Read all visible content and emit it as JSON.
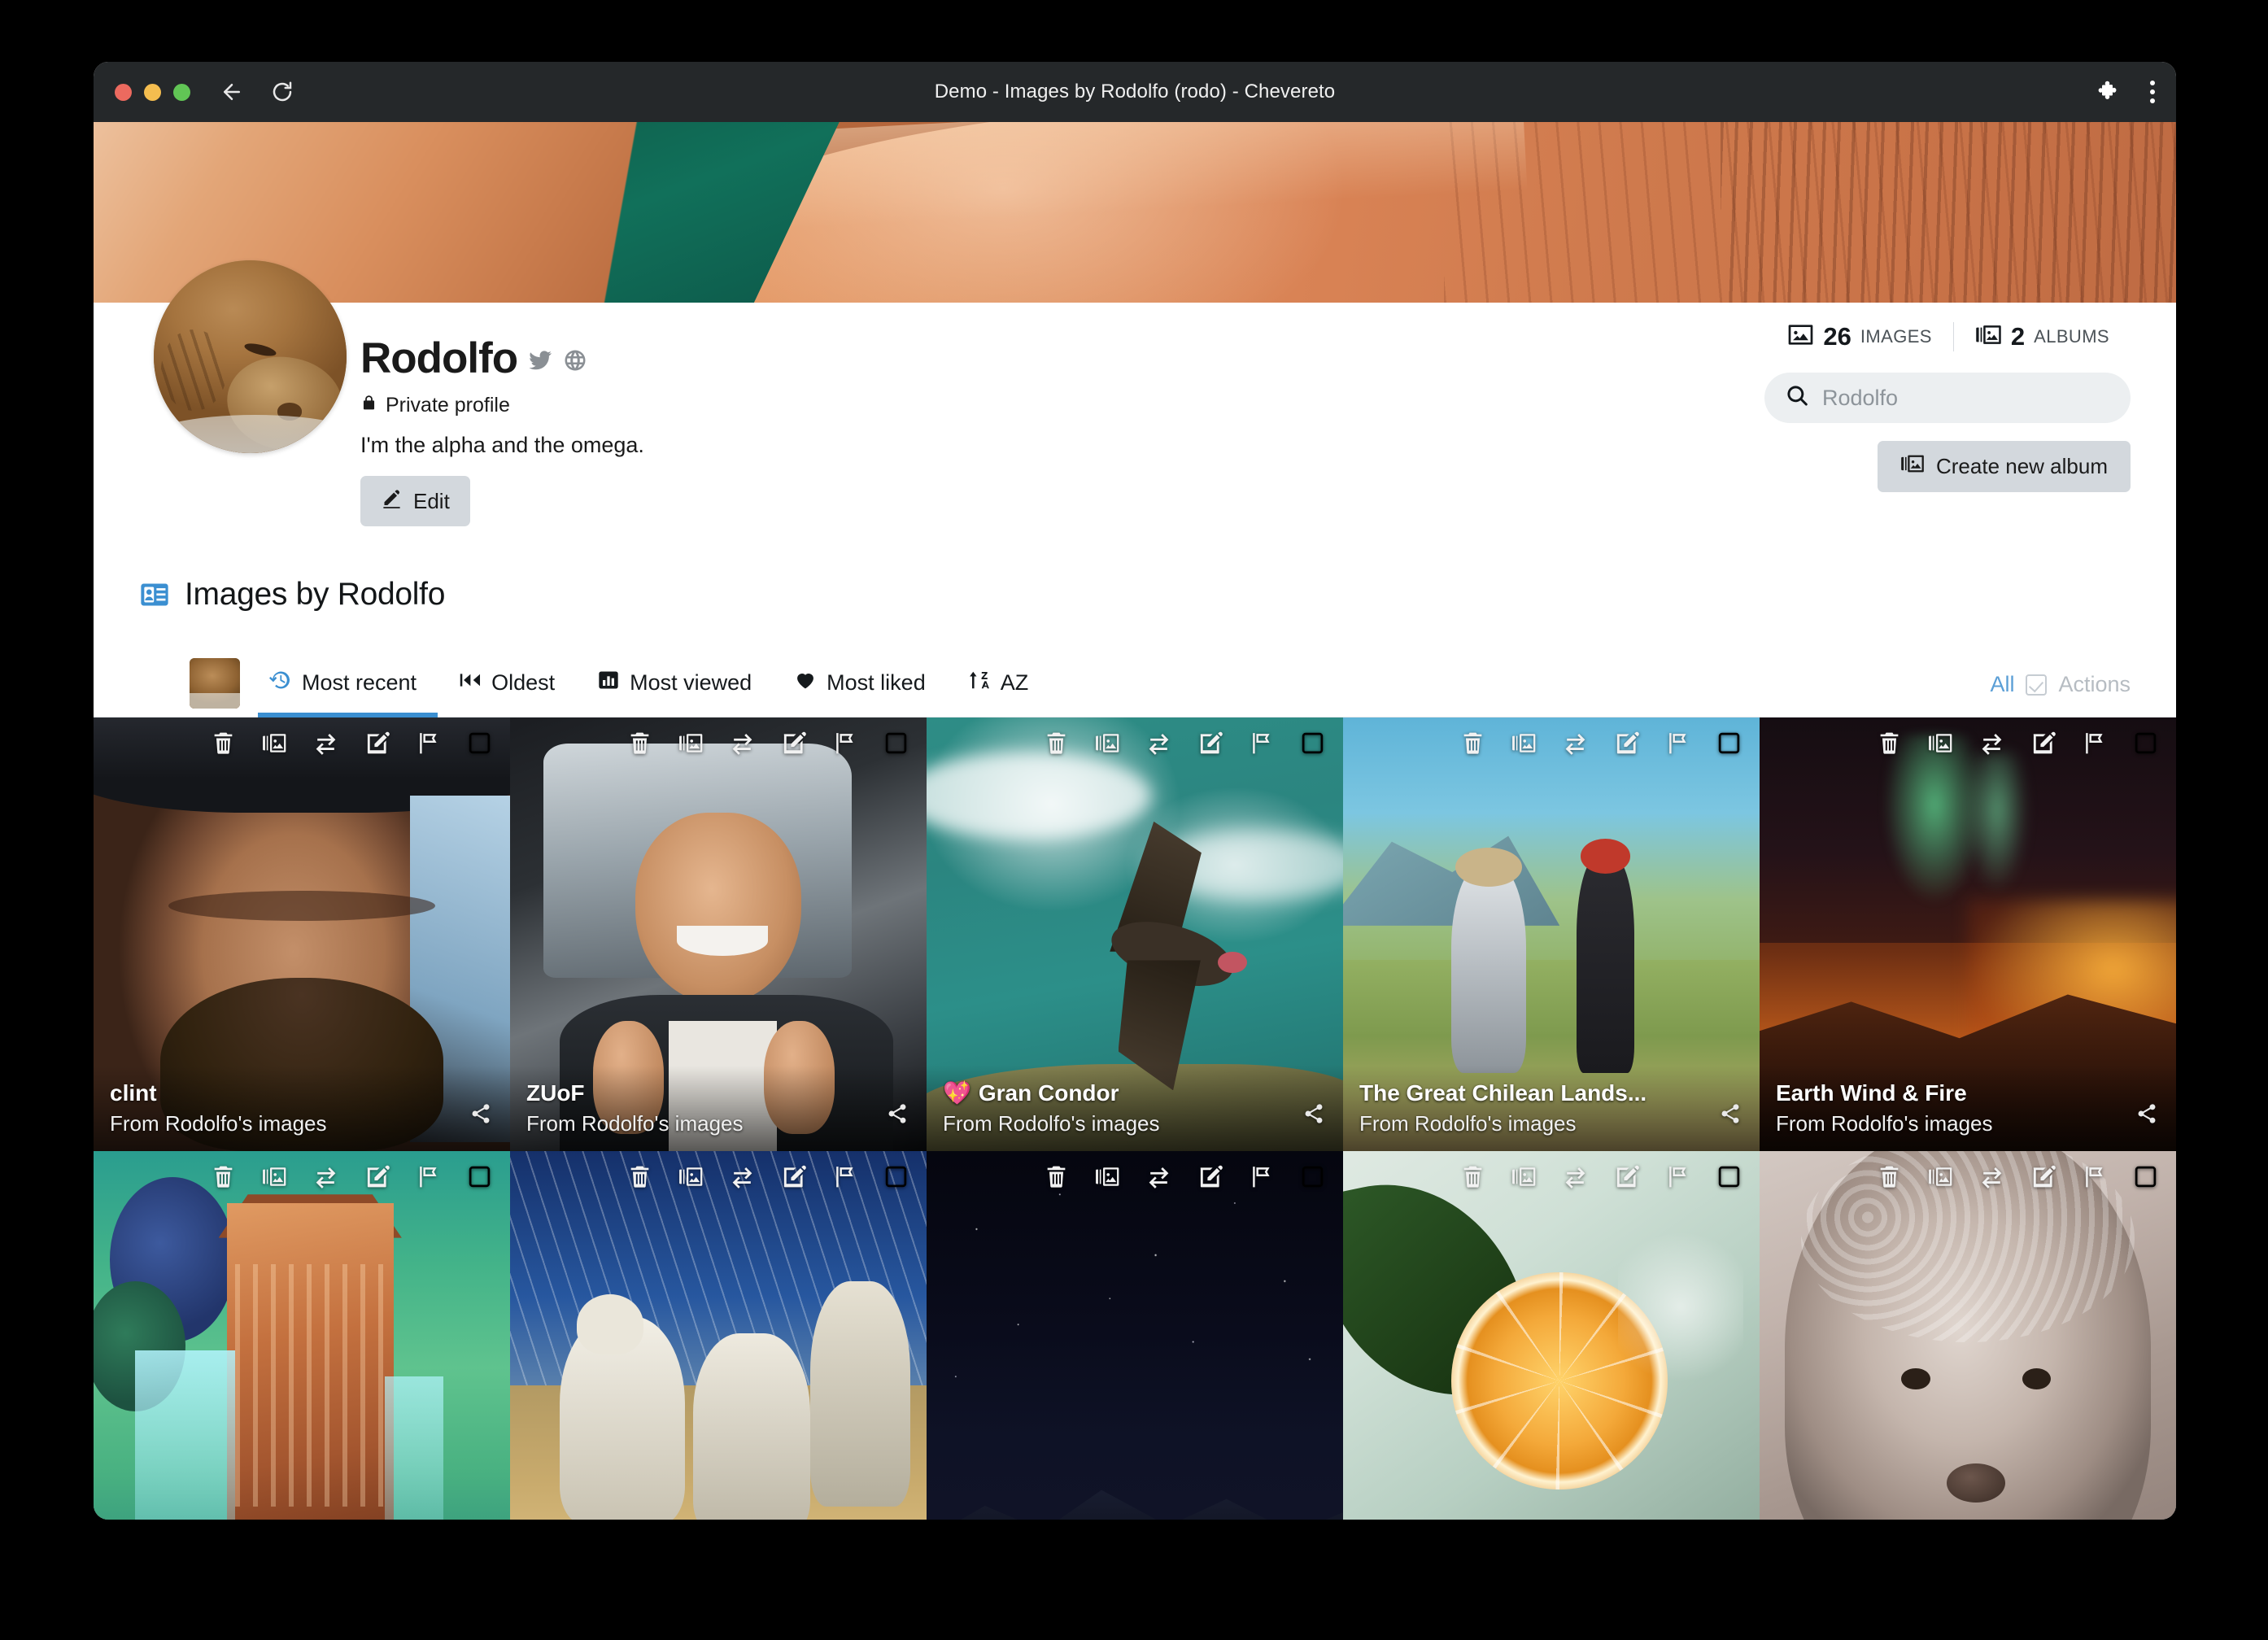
{
  "browser": {
    "tab_title": "Demo - Images by Rodolfo (rodo) - Chevereto",
    "back_icon": "back-arrow-icon",
    "reload_icon": "reload-icon",
    "extensions_icon": "puzzle-piece-icon",
    "menu_icon": "kebab-menu-icon"
  },
  "profile": {
    "username": "Rodolfo",
    "twitter_icon": "twitter-icon",
    "website_icon": "globe-icon",
    "privacy_label": "Private profile",
    "privacy_icon": "lock-icon",
    "bio": "I'm the alpha and the omega.",
    "edit_label": "Edit",
    "edit_icon": "edit-pencil-icon",
    "avatar_alt": "sleeping-sea-lion-avatar",
    "cover_alt": "canyon-river-cover-photo"
  },
  "stats": {
    "images_count": "26",
    "images_label": "IMAGES",
    "images_icon": "image-icon",
    "albums_count": "2",
    "albums_label": "ALBUMS",
    "albums_icon": "albums-icon"
  },
  "search": {
    "placeholder": "Rodolfo",
    "value": "",
    "icon": "search-icon"
  },
  "actions": {
    "create_album_label": "Create new album",
    "create_album_icon": "album-icon"
  },
  "section": {
    "title": "Images by Rodolfo",
    "icon": "id-card-icon"
  },
  "tabs": {
    "items": [
      {
        "label": "Most recent",
        "icon": "history-icon",
        "active": true
      },
      {
        "label": "Oldest",
        "icon": "rewind-icon",
        "active": false
      },
      {
        "label": "Most viewed",
        "icon": "bar-chart-icon",
        "active": false
      },
      {
        "label": "Most liked",
        "icon": "heart-icon",
        "active": false
      },
      {
        "label": "AZ",
        "icon": "sort-alpha-icon",
        "active": false
      }
    ],
    "all_label": "All",
    "actions_label": "Actions",
    "checkbox_icon": "checkbox-checked-icon"
  },
  "card_toolbar_icons": [
    "trash-icon",
    "move-to-album-icon",
    "transfer-icon",
    "edit-icon",
    "flag-icon",
    "select-checkbox-icon"
  ],
  "share_icon": "share-icon",
  "grid": {
    "items": [
      {
        "title": "clint",
        "subtitle": "From Rodolfo's images",
        "badge": "",
        "art": "art-clint",
        "alt": "clint-eastwood-portrait",
        "has_caption": true
      },
      {
        "title": "ZUoF",
        "subtitle": "From Rodolfo's images",
        "badge": "",
        "art": "art-zuof",
        "alt": "man-thumbs-up-in-car",
        "has_caption": true
      },
      {
        "title": "Gran Condor",
        "subtitle": "From Rodolfo's images",
        "badge": "💖",
        "art": "art-condor",
        "alt": "condor-flying-over-ocean",
        "has_caption": true
      },
      {
        "title": "The Great Chilean Lands...",
        "subtitle": "From Rodolfo's images",
        "badge": "",
        "art": "art-chile",
        "alt": "painting-two-figures-landscape",
        "has_caption": true
      },
      {
        "title": "Earth Wind & Fire",
        "subtitle": "From Rodolfo's images",
        "badge": "",
        "art": "art-aurora",
        "alt": "aurora-over-volcanic-ridge",
        "has_caption": true
      },
      {
        "title": "",
        "subtitle": "",
        "badge": "",
        "art": "art-pixel",
        "alt": "pixel-art-jungle-temple",
        "has_caption": false
      },
      {
        "title": "",
        "subtitle": "",
        "badge": "",
        "art": "art-llama",
        "alt": "llamas-in-snow",
        "has_caption": false
      },
      {
        "title": "",
        "subtitle": "",
        "badge": "",
        "art": "art-night",
        "alt": "starry-night-mountains",
        "has_caption": false
      },
      {
        "title": "",
        "subtitle": "",
        "badge": "",
        "art": "art-orange",
        "alt": "orange-slice-with-leaf",
        "has_caption": false
      },
      {
        "title": "",
        "subtitle": "",
        "badge": "",
        "art": "art-alpaca",
        "alt": "alpaca-close-up",
        "has_caption": false
      }
    ]
  },
  "colors": {
    "accent": "#3b8fd1",
    "titlebar": "#25282a",
    "button_bg": "#d3d8dd",
    "muted_text": "#b6bcc2"
  }
}
